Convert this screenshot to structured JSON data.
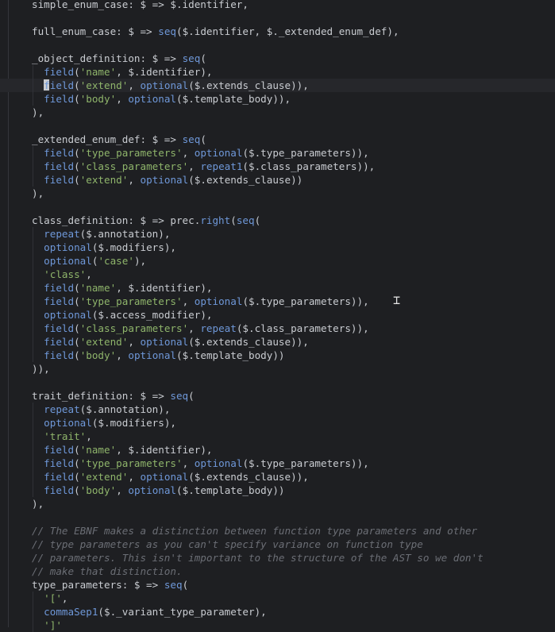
{
  "editor": {
    "lines": [
      {
        "id": "l1",
        "segs": [
          [
            "simple_enum_case: $ => $.identifier,",
            "id"
          ]
        ]
      },
      {
        "id": "l2",
        "segs": []
      },
      {
        "id": "l3",
        "segs": [
          [
            "full_enum_case: $ => ",
            "id"
          ],
          [
            "seg",
            "fn"
          ],
          [
            "($.identifier, $._extended_enum_def),",
            "id"
          ]
        ]
      },
      {
        "id": "l4",
        "segs": []
      },
      {
        "id": "l5",
        "segs": [
          [
            "_object_definition: $ => ",
            "id"
          ],
          [
            "seq",
            "fn"
          ],
          [
            "(",
            "id"
          ]
        ]
      },
      {
        "id": "l6",
        "segs": [
          [
            "  ",
            "id"
          ],
          [
            "field",
            "fn"
          ],
          [
            "(",
            "id"
          ],
          [
            "'name'",
            "str"
          ],
          [
            ", $.identifier),",
            "id"
          ]
        ]
      },
      {
        "id": "l7",
        "current": true,
        "segs": [
          [
            "  ",
            "id"
          ],
          [
            "field",
            "fn"
          ],
          [
            "(",
            "id"
          ],
          [
            "'extend'",
            "str"
          ],
          [
            ", ",
            "id"
          ],
          [
            "optional",
            "fn"
          ],
          [
            "($.extends_clause)),",
            "id"
          ]
        ]
      },
      {
        "id": "l8",
        "segs": [
          [
            "  ",
            "id"
          ],
          [
            "field",
            "fn"
          ],
          [
            "(",
            "id"
          ],
          [
            "'body'",
            "str"
          ],
          [
            ", ",
            "id"
          ],
          [
            "optional",
            "fn"
          ],
          [
            "($.template_body)),",
            "id"
          ]
        ]
      },
      {
        "id": "l9",
        "segs": [
          [
            "),",
            "id"
          ]
        ]
      },
      {
        "id": "l10",
        "segs": []
      },
      {
        "id": "l11",
        "segs": [
          [
            "_extended_enum_def: $ => ",
            "id"
          ],
          [
            "seq",
            "fn"
          ],
          [
            "(",
            "id"
          ]
        ]
      },
      {
        "id": "l12",
        "segs": [
          [
            "  ",
            "id"
          ],
          [
            "field",
            "fn"
          ],
          [
            "(",
            "id"
          ],
          [
            "'type_parameters'",
            "str"
          ],
          [
            ", ",
            "id"
          ],
          [
            "optional",
            "fn"
          ],
          [
            "($.type_parameters)),",
            "id"
          ]
        ]
      },
      {
        "id": "l13",
        "segs": [
          [
            "  ",
            "id"
          ],
          [
            "field",
            "fn"
          ],
          [
            "(",
            "id"
          ],
          [
            "'class_parameters'",
            "str"
          ],
          [
            ", ",
            "id"
          ],
          [
            "repeat1",
            "fn"
          ],
          [
            "($.class_parameters)),",
            "id"
          ]
        ]
      },
      {
        "id": "l14",
        "segs": [
          [
            "  ",
            "id"
          ],
          [
            "field",
            "fn"
          ],
          [
            "(",
            "id"
          ],
          [
            "'extend'",
            "str"
          ],
          [
            ", ",
            "id"
          ],
          [
            "optional",
            "fn"
          ],
          [
            "($.extends_clause))",
            "id"
          ]
        ]
      },
      {
        "id": "l15",
        "segs": [
          [
            "),",
            "id"
          ]
        ]
      },
      {
        "id": "l16",
        "segs": []
      },
      {
        "id": "l17",
        "segs": [
          [
            "class_definition: $ => prec.",
            "id"
          ],
          [
            "right",
            "fn"
          ],
          [
            "(",
            "id"
          ],
          [
            "seq",
            "fn"
          ],
          [
            "(",
            "id"
          ]
        ]
      },
      {
        "id": "l18",
        "segs": [
          [
            "  ",
            "id"
          ],
          [
            "repeat",
            "fn"
          ],
          [
            "($.annotation),",
            "id"
          ]
        ]
      },
      {
        "id": "l19",
        "segs": [
          [
            "  ",
            "id"
          ],
          [
            "optional",
            "fn"
          ],
          [
            "($.modifiers),",
            "id"
          ]
        ]
      },
      {
        "id": "l20",
        "segs": [
          [
            "  ",
            "id"
          ],
          [
            "optional",
            "fn"
          ],
          [
            "(",
            "id"
          ],
          [
            "'case'",
            "str"
          ],
          [
            "),",
            "id"
          ]
        ]
      },
      {
        "id": "l21",
        "segs": [
          [
            "  ",
            "id"
          ],
          [
            "'class'",
            "str"
          ],
          [
            ",",
            "id"
          ]
        ]
      },
      {
        "id": "l22",
        "segs": [
          [
            "  ",
            "id"
          ],
          [
            "field",
            "fn"
          ],
          [
            "(",
            "id"
          ],
          [
            "'name'",
            "str"
          ],
          [
            ", $.identifier),",
            "id"
          ]
        ]
      },
      {
        "id": "l23",
        "segs": [
          [
            "  ",
            "id"
          ],
          [
            "field",
            "fn"
          ],
          [
            "(",
            "id"
          ],
          [
            "'type_parameters'",
            "str"
          ],
          [
            ", ",
            "id"
          ],
          [
            "optional",
            "fn"
          ],
          [
            "($.type_parameters)),",
            "id"
          ]
        ]
      },
      {
        "id": "l24",
        "segs": [
          [
            "  ",
            "id"
          ],
          [
            "optional",
            "fn"
          ],
          [
            "($.access_modifier),",
            "id"
          ]
        ]
      },
      {
        "id": "l25",
        "segs": [
          [
            "  ",
            "id"
          ],
          [
            "field",
            "fn"
          ],
          [
            "(",
            "id"
          ],
          [
            "'class_parameters'",
            "str"
          ],
          [
            ", ",
            "id"
          ],
          [
            "repeat",
            "fn"
          ],
          [
            "($.class_parameters)),",
            "id"
          ]
        ]
      },
      {
        "id": "l26",
        "segs": [
          [
            "  ",
            "id"
          ],
          [
            "field",
            "fn"
          ],
          [
            "(",
            "id"
          ],
          [
            "'extend'",
            "str"
          ],
          [
            ", ",
            "id"
          ],
          [
            "optional",
            "fn"
          ],
          [
            "($.extends_clause)),",
            "id"
          ]
        ]
      },
      {
        "id": "l27",
        "segs": [
          [
            "  ",
            "id"
          ],
          [
            "field",
            "fn"
          ],
          [
            "(",
            "id"
          ],
          [
            "'body'",
            "str"
          ],
          [
            ", ",
            "id"
          ],
          [
            "optional",
            "fn"
          ],
          [
            "($.template_body))",
            "id"
          ]
        ]
      },
      {
        "id": "l28",
        "segs": [
          [
            ")),",
            "id"
          ]
        ]
      },
      {
        "id": "l29",
        "segs": []
      },
      {
        "id": "l30",
        "segs": [
          [
            "trait_definition: $ => ",
            "id"
          ],
          [
            "seq",
            "fn"
          ],
          [
            "(",
            "id"
          ]
        ]
      },
      {
        "id": "l31",
        "segs": [
          [
            "  ",
            "id"
          ],
          [
            "repeat",
            "fn"
          ],
          [
            "($.annotation),",
            "id"
          ]
        ]
      },
      {
        "id": "l32",
        "segs": [
          [
            "  ",
            "id"
          ],
          [
            "optional",
            "fn"
          ],
          [
            "($.modifiers),",
            "id"
          ]
        ]
      },
      {
        "id": "l33",
        "segs": [
          [
            "  ",
            "id"
          ],
          [
            "'trait'",
            "str"
          ],
          [
            ",",
            "id"
          ]
        ]
      },
      {
        "id": "l34",
        "segs": [
          [
            "  ",
            "id"
          ],
          [
            "field",
            "fn"
          ],
          [
            "(",
            "id"
          ],
          [
            "'name'",
            "str"
          ],
          [
            ", $.identifier),",
            "id"
          ]
        ]
      },
      {
        "id": "l35",
        "segs": [
          [
            "  ",
            "id"
          ],
          [
            "field",
            "fn"
          ],
          [
            "(",
            "id"
          ],
          [
            "'type_parameters'",
            "str"
          ],
          [
            ", ",
            "id"
          ],
          [
            "optional",
            "fn"
          ],
          [
            "($.type_parameters)),",
            "id"
          ]
        ]
      },
      {
        "id": "l36",
        "segs": [
          [
            "  ",
            "id"
          ],
          [
            "field",
            "fn"
          ],
          [
            "(",
            "id"
          ],
          [
            "'extend'",
            "str"
          ],
          [
            ", ",
            "id"
          ],
          [
            "optional",
            "fn"
          ],
          [
            "($.extends_clause)),",
            "id"
          ]
        ]
      },
      {
        "id": "l37",
        "segs": [
          [
            "  ",
            "id"
          ],
          [
            "field",
            "fn"
          ],
          [
            "(",
            "id"
          ],
          [
            "'body'",
            "str"
          ],
          [
            ", ",
            "id"
          ],
          [
            "optional",
            "fn"
          ],
          [
            "($.template_body))",
            "id"
          ]
        ]
      },
      {
        "id": "l38",
        "segs": [
          [
            "),",
            "id"
          ]
        ]
      },
      {
        "id": "l39",
        "segs": []
      },
      {
        "id": "l40",
        "segs": [
          [
            "// The EBNF makes a distinction between function type parameters and other",
            "cm"
          ]
        ]
      },
      {
        "id": "l41",
        "segs": [
          [
            "// type parameters as you can't specify variance on function type",
            "cm"
          ]
        ]
      },
      {
        "id": "l42",
        "segs": [
          [
            "// parameters. This isn't important to the structure of the AST so we don't",
            "cm"
          ]
        ]
      },
      {
        "id": "l43",
        "segs": [
          [
            "// make that distinction.",
            "cm"
          ]
        ]
      },
      {
        "id": "l44",
        "segs": [
          [
            "type_parameters: $ => ",
            "id"
          ],
          [
            "seq",
            "fn"
          ],
          [
            "(",
            "id"
          ]
        ]
      },
      {
        "id": "l45",
        "segs": [
          [
            "  ",
            "id"
          ],
          [
            "'['",
            "str"
          ],
          [
            ",",
            "id"
          ]
        ]
      },
      {
        "id": "l46",
        "segs": [
          [
            "  ",
            "id"
          ],
          [
            "commaSep1",
            "fn"
          ],
          [
            "($._variant_type_parameter),",
            "id"
          ]
        ]
      },
      {
        "id": "l47",
        "segs": [
          [
            "  ",
            "id"
          ],
          [
            "']'",
            "str"
          ]
        ]
      }
    ]
  },
  "colors": {
    "background": "#1e1f22",
    "identifier": "#c9ccd1",
    "function": "#6f98d9",
    "string": "#8fb56b",
    "comment": "#6b6e75"
  },
  "icons": {
    "mouse_cursor": "ibeam-cursor-icon"
  }
}
